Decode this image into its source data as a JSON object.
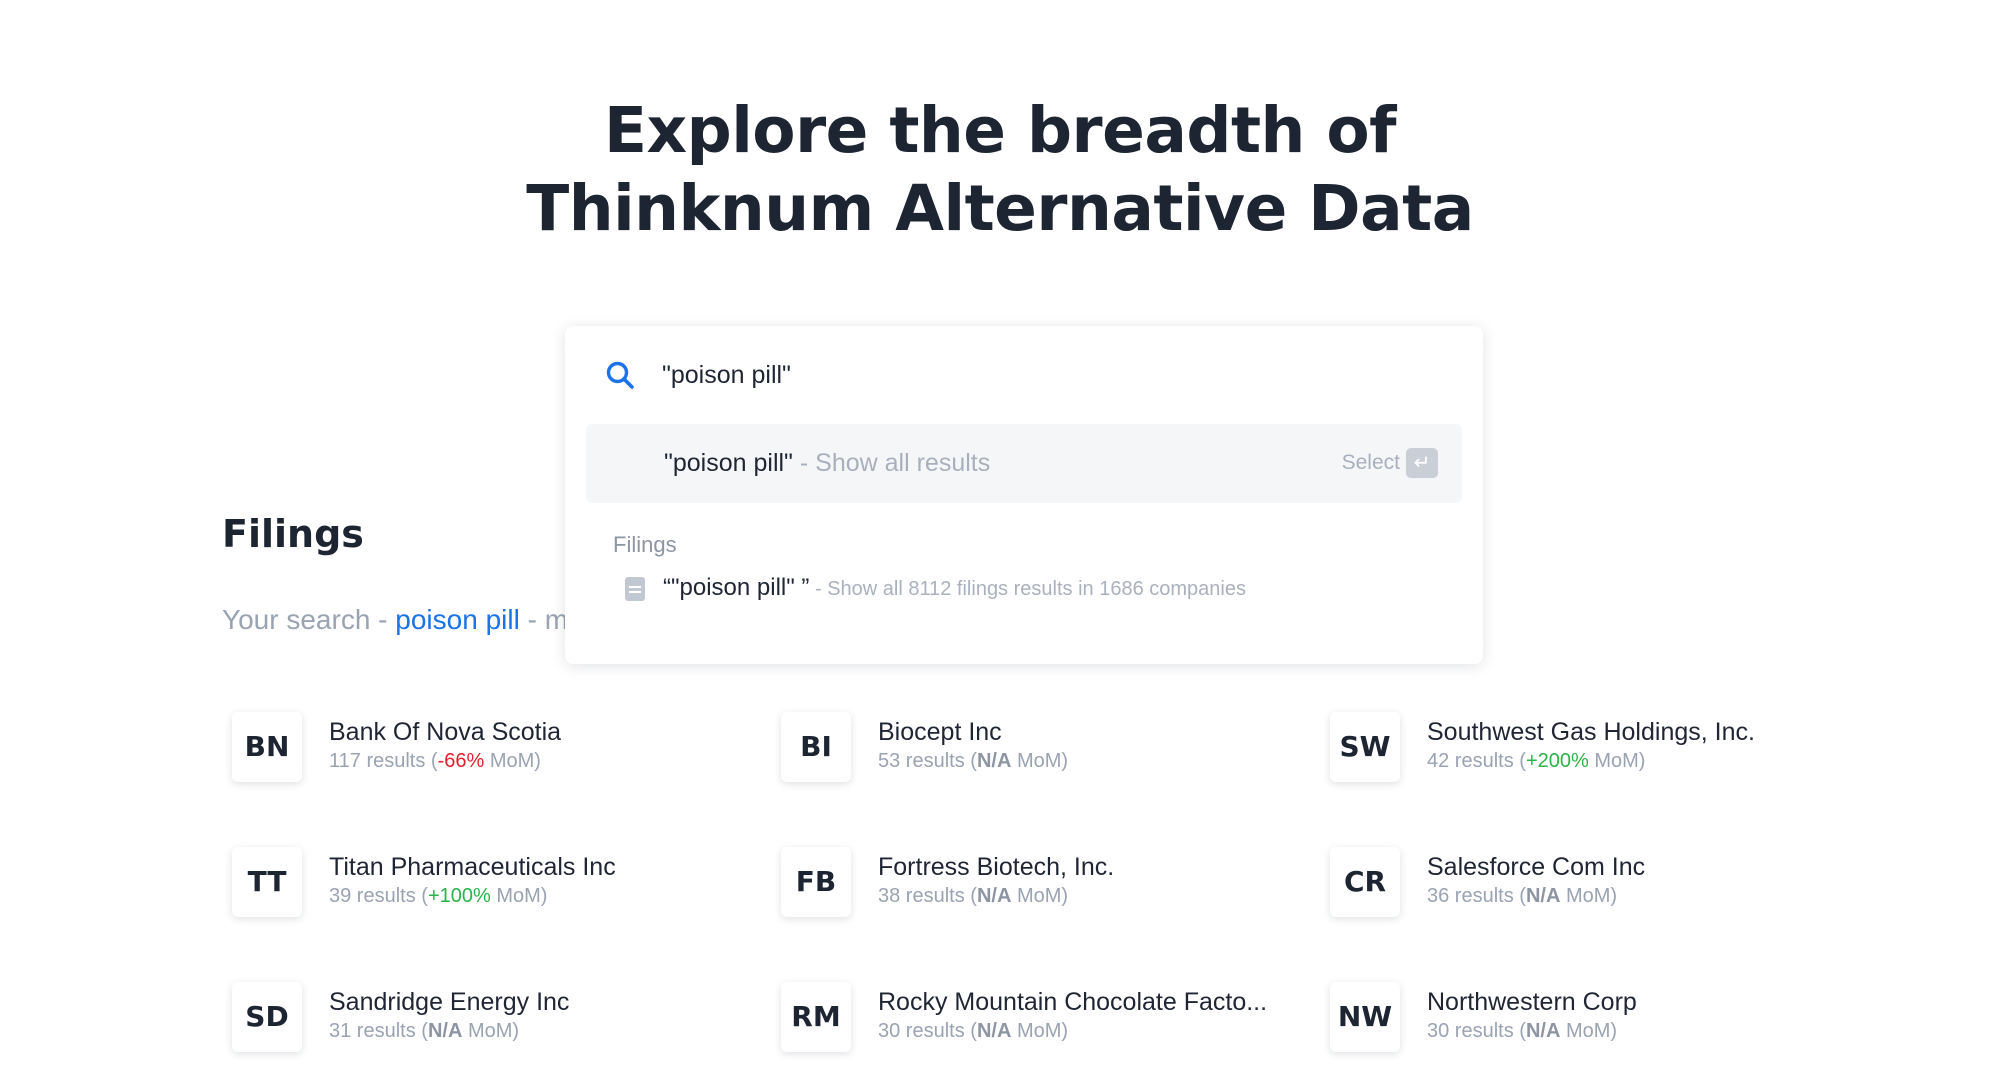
{
  "hero": {
    "title_line1": "Explore the breadth of",
    "title_line2": "Thinknum Alternative Data"
  },
  "search": {
    "query": "\"poison pill\"",
    "suggestion_query": "\"poison pill\"",
    "suggestion_hint": " - Show all results",
    "select_label": "Select",
    "enter_key": "↵",
    "group_label": "Filings",
    "filing_query": "“\"poison pill\" ”",
    "filing_hint": " - Show all 8112 filings results in 1686 companies"
  },
  "filings": {
    "title": "Filings",
    "summary_prefix": "Your search - ",
    "summary_term": "poison pill",
    "summary_suffix": " - m"
  },
  "companies": [
    {
      "ticker": "BN",
      "name": "Bank Of Nova Scotia",
      "results": "117 results",
      "change": "-66%",
      "change_type": "neg"
    },
    {
      "ticker": "BI",
      "name": "Biocept Inc",
      "results": "53 results",
      "change": "N/A",
      "change_type": "na"
    },
    {
      "ticker": "SW",
      "name": "Southwest Gas Holdings, Inc.",
      "results": "42 results",
      "change": "+200%",
      "change_type": "pos"
    },
    {
      "ticker": "TT",
      "name": "Titan Pharmaceuticals Inc",
      "results": "39 results",
      "change": "+100%",
      "change_type": "pos"
    },
    {
      "ticker": "FB",
      "name": "Fortress Biotech, Inc.",
      "results": "38 results",
      "change": "N/A",
      "change_type": "na"
    },
    {
      "ticker": "CR",
      "name": "Salesforce Com Inc",
      "results": "36 results",
      "change": "N/A",
      "change_type": "na"
    },
    {
      "ticker": "SD",
      "name": "Sandridge Energy Inc",
      "results": "31 results",
      "change": "N/A",
      "change_type": "na"
    },
    {
      "ticker": "RM",
      "name": "Rocky Mountain Chocolate Facto...",
      "results": "30 results",
      "change": "N/A",
      "change_type": "na"
    },
    {
      "ticker": "NW",
      "name": "Northwestern Corp",
      "results": "30 results",
      "change": "N/A",
      "change_type": "na"
    }
  ],
  "labels": {
    "mom_open": " (",
    "mom_close": " MoM)"
  },
  "colors": {
    "accent": "#1a73e8",
    "negative": "#e0202c",
    "positive": "#2bb34b"
  }
}
